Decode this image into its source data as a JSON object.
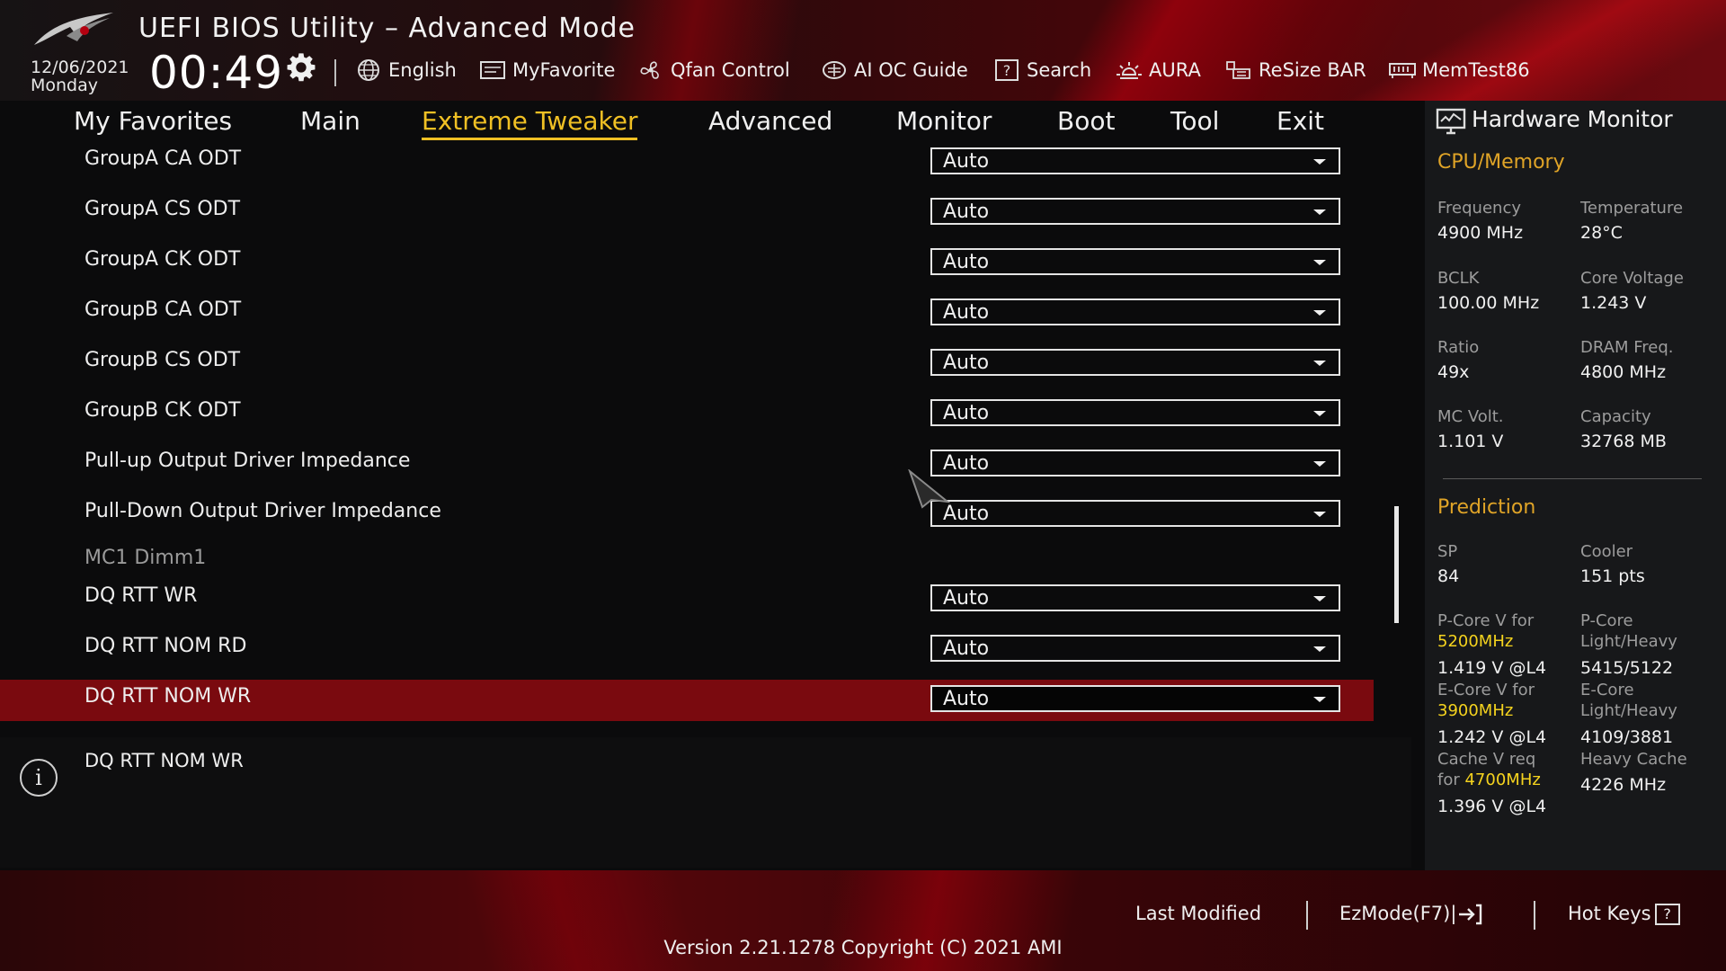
{
  "header": {
    "title": "UEFI BIOS Utility – Advanced Mode",
    "date": "12/06/2021",
    "day": "Monday",
    "time": "00:49",
    "items": [
      {
        "label": "English",
        "icon": "globe-icon"
      },
      {
        "label": "MyFavorite",
        "icon": "favorite-icon"
      },
      {
        "label": "Qfan Control",
        "icon": "fan-icon"
      },
      {
        "label": "AI OC Guide",
        "icon": "chip-icon"
      },
      {
        "label": "Search",
        "icon": "question-box-icon"
      },
      {
        "label": "AURA",
        "icon": "aura-light-icon"
      },
      {
        "label": "ReSize BAR",
        "icon": "resize-bar-icon"
      },
      {
        "label": "MemTest86",
        "icon": "memory-icon"
      }
    ]
  },
  "nav": {
    "tabs": [
      {
        "label": "My Favorites"
      },
      {
        "label": "Main"
      },
      {
        "label": "Extreme Tweaker",
        "active": true
      },
      {
        "label": "Advanced"
      },
      {
        "label": "Monitor"
      },
      {
        "label": "Boot"
      },
      {
        "label": "Tool"
      },
      {
        "label": "Exit"
      }
    ]
  },
  "settings": {
    "rows": [
      {
        "label": "GroupA CA ODT",
        "value": "Auto"
      },
      {
        "label": "GroupA CS ODT",
        "value": "Auto"
      },
      {
        "label": "GroupA CK ODT",
        "value": "Auto"
      },
      {
        "label": "GroupB CA ODT",
        "value": "Auto"
      },
      {
        "label": "GroupB CS ODT",
        "value": "Auto"
      },
      {
        "label": "GroupB CK ODT",
        "value": "Auto"
      },
      {
        "label": "Pull-up Output Driver Impedance",
        "value": "Auto"
      },
      {
        "label": "Pull-Down Output Driver Impedance",
        "value": "Auto"
      }
    ],
    "section_label": "MC1 Dimm1",
    "rows2": [
      {
        "label": "DQ RTT WR",
        "value": "Auto"
      },
      {
        "label": "DQ RTT NOM RD",
        "value": "Auto"
      },
      {
        "label": "DQ RTT NOM WR",
        "value": "Auto",
        "selected": true
      }
    ]
  },
  "info": {
    "icon": "info-icon",
    "text": "DQ RTT NOM WR"
  },
  "hardware_monitor": {
    "title": "Hardware Monitor",
    "cpu_memory": {
      "heading": "CPU/Memory",
      "frequency_label": "Frequency",
      "frequency": "4900 MHz",
      "temperature_label": "Temperature",
      "temperature": "28°C",
      "bclk_label": "BCLK",
      "bclk": "100.00 MHz",
      "core_voltage_label": "Core Voltage",
      "core_voltage": "1.243 V",
      "ratio_label": "Ratio",
      "ratio": "49x",
      "dram_freq_label": "DRAM Freq.",
      "dram_freq": "4800 MHz",
      "mc_volt_label": "MC Volt.",
      "mc_volt": "1.101 V",
      "capacity_label": "Capacity",
      "capacity": "32768 MB"
    },
    "prediction": {
      "heading": "Prediction",
      "sp_label": "SP",
      "sp": "84",
      "cooler_label": "Cooler",
      "cooler": "151 pts",
      "pcore_v_label": "P-Core V for",
      "pcore_v_freq": "5200MHz",
      "pcore_v": "1.419 V @L4",
      "pcore_lh_label1": "P-Core",
      "pcore_lh_label2": "Light/Heavy",
      "pcore_lh": "5415/5122",
      "ecore_v_label": "E-Core V for",
      "ecore_v_freq": "3900MHz",
      "ecore_v": "1.242 V @L4",
      "ecore_lh_label1": "E-Core",
      "ecore_lh_label2": "Light/Heavy",
      "ecore_lh": "4109/3881",
      "cache_v_label1": "Cache V req",
      "cache_v_label2": "for",
      "cache_v_freq": "4700MHz",
      "cache_v": "1.396 V @L4",
      "heavy_cache_label": "Heavy Cache",
      "heavy_cache": "4226 MHz"
    }
  },
  "footer": {
    "last_modified": "Last Modified",
    "ezmode": "EzMode(F7)|",
    "hotkeys": "Hot Keys",
    "version": "Version 2.21.1278 Copyright (C) 2021 AMI"
  },
  "colors": {
    "accent": "#f0c024",
    "selected_row": "#7a0a0f",
    "highlight": "#f5d31e"
  }
}
